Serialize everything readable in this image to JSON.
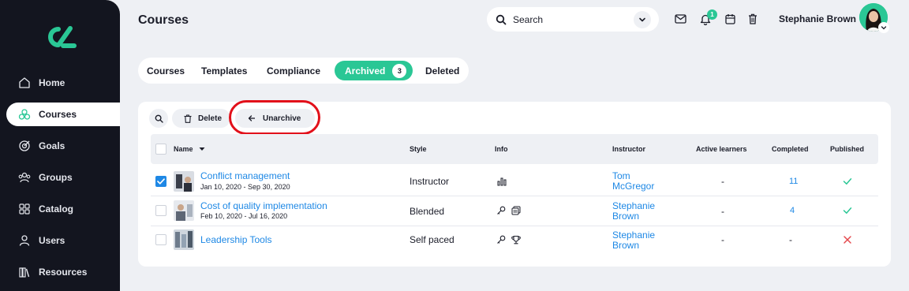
{
  "header": {
    "title": "Courses",
    "search_placeholder": "Search",
    "notification_count": "1",
    "user_name": "Stephanie Brown"
  },
  "sidebar": {
    "items": [
      {
        "label": "Home",
        "icon": "home-icon"
      },
      {
        "label": "Courses",
        "icon": "courses-icon",
        "active": true
      },
      {
        "label": "Goals",
        "icon": "target-icon"
      },
      {
        "label": "Groups",
        "icon": "groups-icon"
      },
      {
        "label": "Catalog",
        "icon": "catalog-icon"
      },
      {
        "label": "Users",
        "icon": "user-icon"
      },
      {
        "label": "Resources",
        "icon": "books-icon"
      }
    ]
  },
  "tabs": [
    {
      "label": "Courses"
    },
    {
      "label": "Templates"
    },
    {
      "label": "Compliance"
    },
    {
      "label": "Archived",
      "count": "3",
      "active": true
    },
    {
      "label": "Deleted"
    }
  ],
  "toolbar": {
    "delete_label": "Delete",
    "unarchive_label": "Unarchive"
  },
  "table": {
    "columns": [
      "Name",
      "Style",
      "Info",
      "Instructor",
      "Active learners",
      "Completed",
      "Published"
    ],
    "rows": [
      {
        "name": "Conflict management",
        "dates": "Jan 10, 2020 - Sep 30, 2020",
        "style": "Instructor",
        "info": [
          "chart-icon"
        ],
        "instructor": "Tom McGregor",
        "active_learners": "-",
        "completed": "11",
        "published": true,
        "checked": true
      },
      {
        "name": "Cost of quality implementation",
        "dates": "Feb 10, 2020 - Jul 16, 2020",
        "style": "Blended",
        "info": [
          "key-icon",
          "stack-icon"
        ],
        "instructor": "Stephanie Brown",
        "active_learners": "-",
        "completed": "4",
        "published": true,
        "checked": false
      },
      {
        "name": "Leadership Tools",
        "dates": "",
        "style": "Self paced",
        "info": [
          "key-icon",
          "trophy-icon"
        ],
        "instructor": "Stephanie Brown",
        "active_learners": "-",
        "completed": "-",
        "published": false,
        "checked": false
      }
    ]
  },
  "colors": {
    "accent": "#2ac795",
    "link": "#1e88e5",
    "sidebar_bg": "#13151f",
    "highlight": "#e2101a",
    "error": "#e5484d"
  }
}
